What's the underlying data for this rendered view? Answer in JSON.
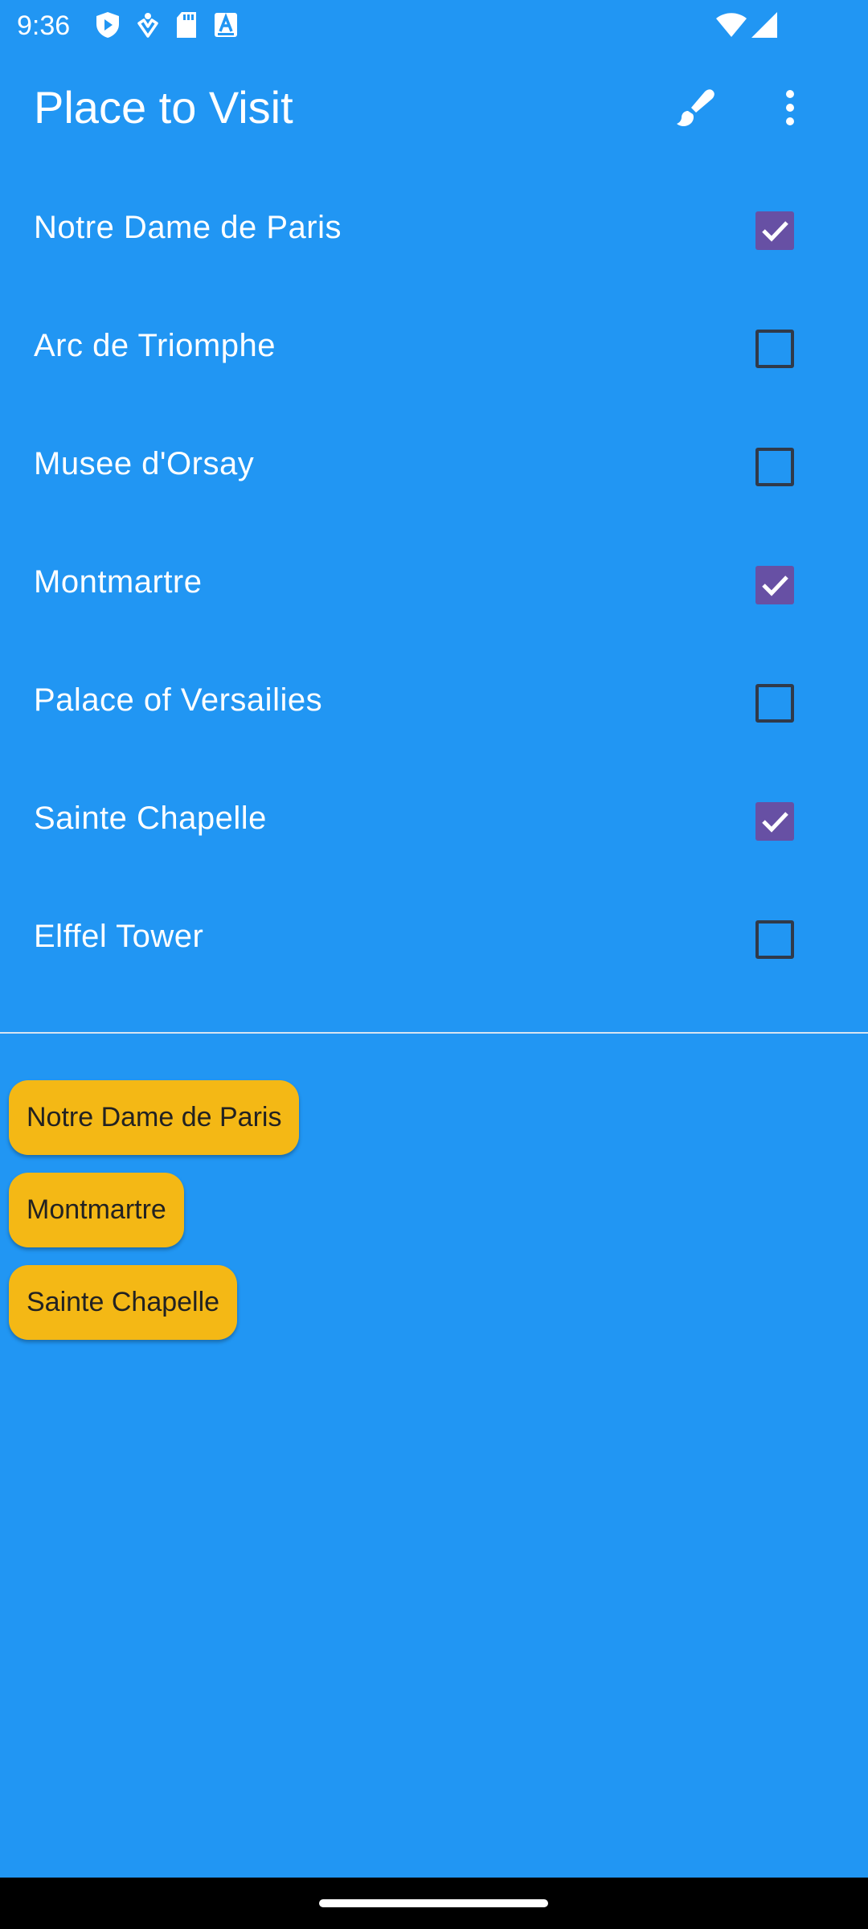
{
  "status_bar": {
    "time": "9:36",
    "left_icons": [
      "shield-icon",
      "fitness-icon",
      "sd-card-icon",
      "text-a-icon"
    ],
    "right_icons": [
      "wifi-icon",
      "signal-icon"
    ]
  },
  "app_bar": {
    "title": "Place to Visit",
    "actions": [
      "brush-icon",
      "more-vert-icon"
    ]
  },
  "places": [
    {
      "label": "Notre Dame de Paris",
      "checked": true
    },
    {
      "label": "Arc de Triomphe",
      "checked": false
    },
    {
      "label": "Musee d'Orsay",
      "checked": false
    },
    {
      "label": "Montmartre",
      "checked": true
    },
    {
      "label": "Palace of Versailies",
      "checked": false
    },
    {
      "label": "Sainte Chapelle",
      "checked": true
    },
    {
      "label": "Elffel Tower",
      "checked": false
    }
  ],
  "selected_chips": [
    "Notre Dame de Paris",
    "Montmartre",
    "Sainte Chapelle"
  ],
  "colors": {
    "background": "#2196F3",
    "checkbox_checked": "#6750A4",
    "chip": "#F4B815"
  }
}
